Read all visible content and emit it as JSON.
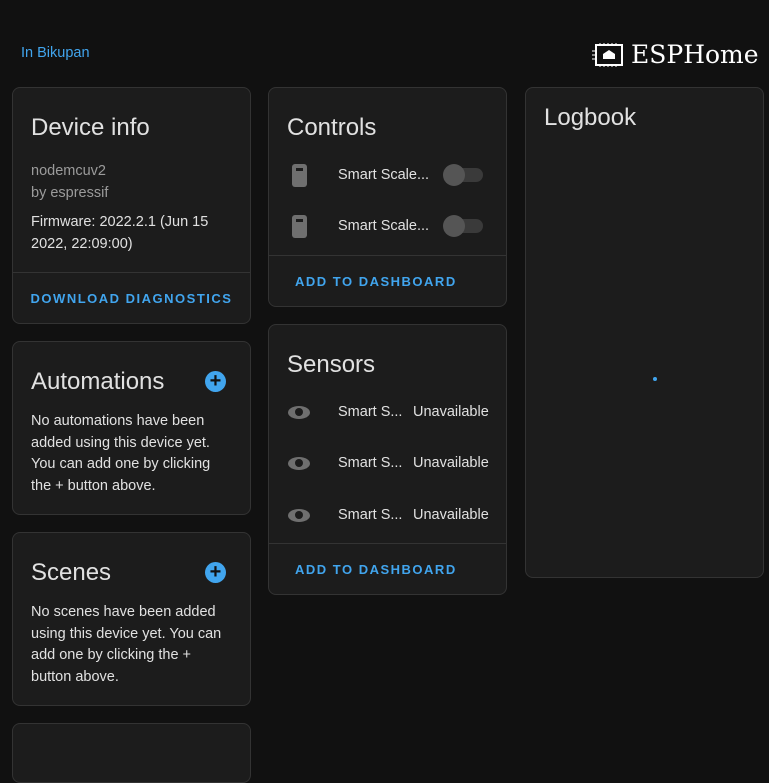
{
  "header": {
    "area_link": "In Bikupan",
    "brand": "ESPHome"
  },
  "device_info": {
    "title": "Device info",
    "model": "nodemcuv2",
    "manufacturer": "by espressif",
    "firmware": "Firmware: 2022.2.1 (Jun 15 2022, 22:09:00)",
    "action": "DOWNLOAD DIAGNOSTICS"
  },
  "automations": {
    "title": "Automations",
    "text": "No automations have been added using this device yet. You can add one by clicking the + button above."
  },
  "scenes": {
    "title": "Scenes",
    "text": "No scenes have been added using this device yet. You can add one by clicking the + button above."
  },
  "controls": {
    "title": "Controls",
    "items": [
      {
        "name": "Smart Scale..."
      },
      {
        "name": "Smart Scale..."
      }
    ],
    "action": "ADD TO DASHBOARD"
  },
  "sensors": {
    "title": "Sensors",
    "items": [
      {
        "name": "Smart S...",
        "state": "Unavailable"
      },
      {
        "name": "Smart S...",
        "state": "Unavailable"
      },
      {
        "name": "Smart S...",
        "state": "Unavailable"
      }
    ],
    "action": "ADD TO DASHBOARD"
  },
  "logbook": {
    "title": "Logbook"
  }
}
